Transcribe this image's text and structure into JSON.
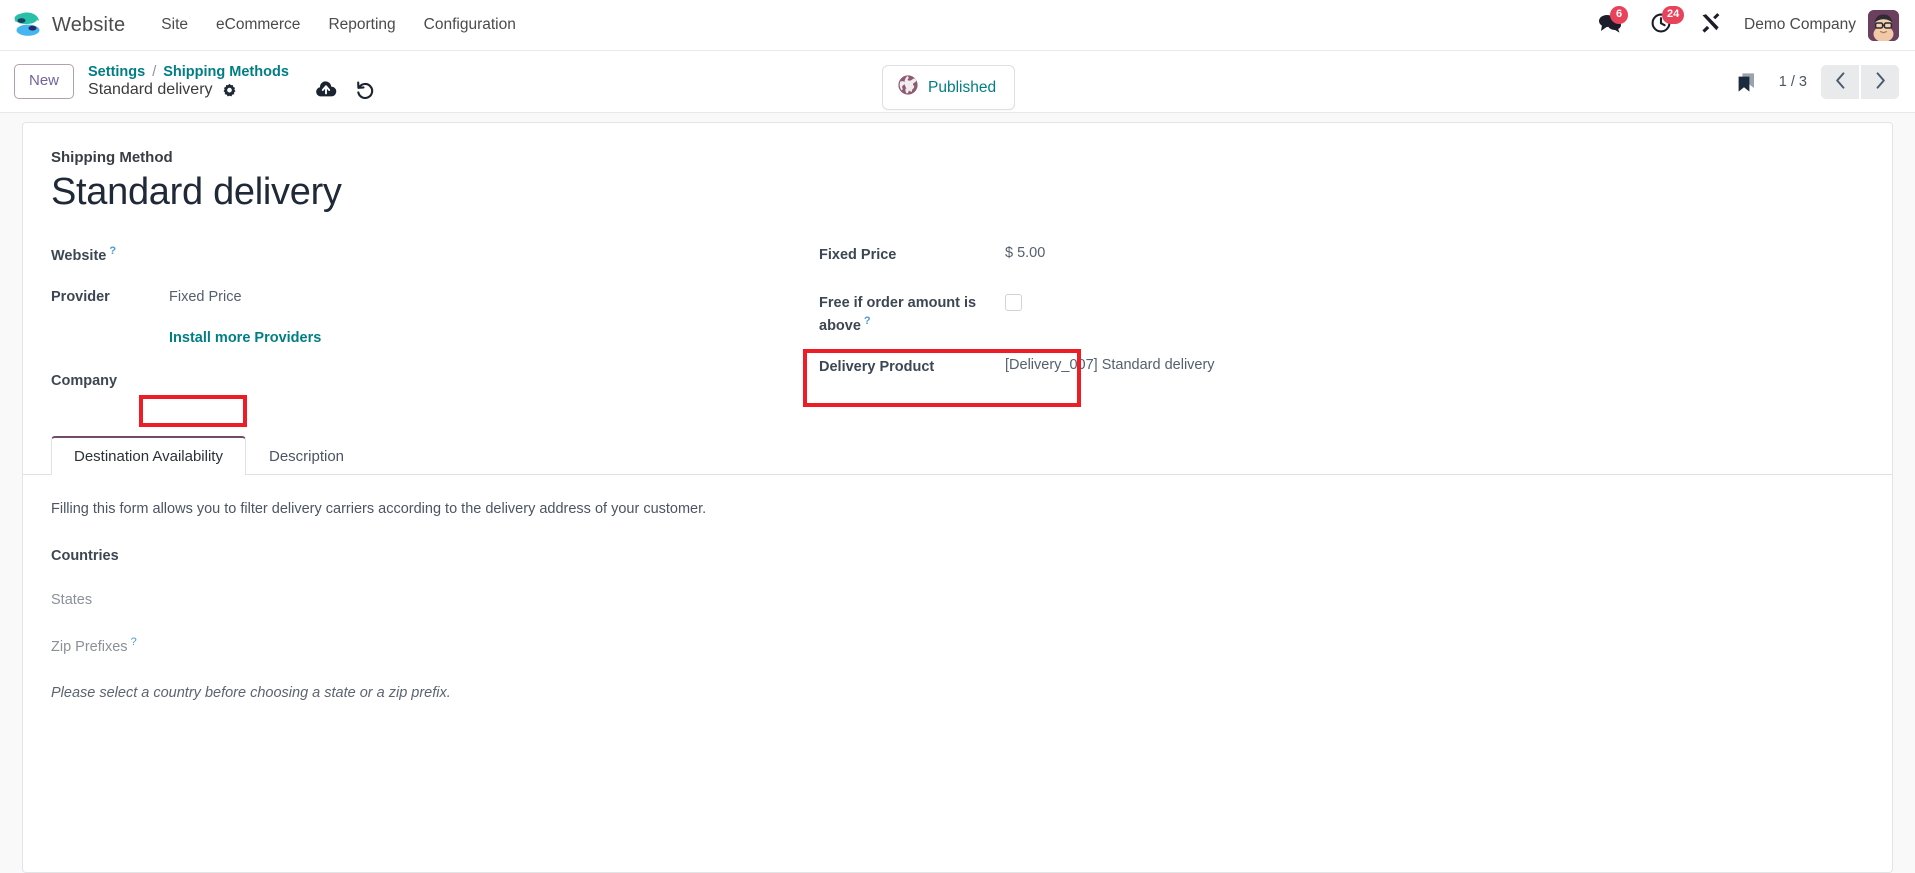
{
  "navbar": {
    "brand": "Website",
    "logo_icon": "odoo-website-logo-icon",
    "menu": [
      {
        "label": "Site"
      },
      {
        "label": "eCommerce"
      },
      {
        "label": "Reporting"
      },
      {
        "label": "Configuration"
      }
    ],
    "messages": {
      "icon": "chat-bubbles-icon",
      "count": "6"
    },
    "activities": {
      "icon": "clock-icon",
      "count": "24"
    },
    "debug": {
      "icon": "tools-wrench-icon"
    },
    "company": "Demo Company",
    "avatar_icon": "user-avatar-icon"
  },
  "control_panel": {
    "new_button": "New",
    "breadcrumb": {
      "root": "Settings",
      "separator": "/",
      "parent": "Shipping Methods",
      "current": "Standard delivery",
      "gear_icon": "gear-icon"
    },
    "save_icon": "cloud-upload-icon",
    "discard_icon": "undo-icon",
    "published": {
      "label": "Published",
      "icon": "globe-icon"
    },
    "bookmark_icon": "bookmark-icon",
    "pager": {
      "count": "1 / 3",
      "prev_icon": "chevron-left-icon",
      "next_icon": "chevron-right-icon"
    }
  },
  "form": {
    "subtitle": "Shipping Method",
    "title": "Standard delivery",
    "left_fields": {
      "website_label": "Website",
      "website_value": "",
      "provider_label": "Provider",
      "provider_value": "Fixed Price",
      "install_link": "Install more Providers",
      "company_label": "Company",
      "company_value": ""
    },
    "right_fields": {
      "fixed_price_label": "Fixed Price",
      "fixed_price_value": "$  5.00",
      "free_above_label": "Free if order amount is above",
      "free_above_checked": false,
      "delivery_product_label": "Delivery Product",
      "delivery_product_value": "[Delivery_007] Standard delivery"
    },
    "help_marker": "?"
  },
  "notebook": {
    "tabs": [
      {
        "label": "Destination Availability",
        "active": true
      },
      {
        "label": "Description",
        "active": false
      }
    ],
    "panel": {
      "intro": "Filling this form allows you to filter delivery carriers according to the delivery address of your customer.",
      "countries_label": "Countries",
      "countries_value": "",
      "states_label": "States",
      "states_value": "",
      "zip_label": "Zip Prefixes",
      "zip_value": "",
      "note": "Please select a country before choosing a state or a zip prefix."
    }
  },
  "annotations": {
    "provider_highlight": "red-rectangle-provider",
    "fixed_price_highlight": "red-rectangle-fixed-price",
    "color": "#ee1c25"
  }
}
